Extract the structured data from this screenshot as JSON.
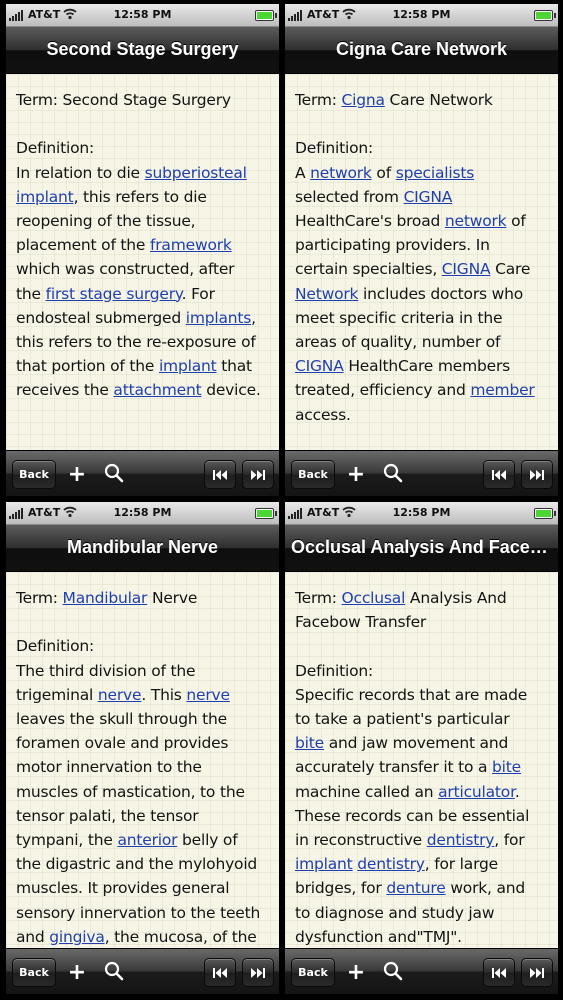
{
  "status_bar": {
    "carrier": "AT&T",
    "time": "12:58 PM"
  },
  "toolbar": {
    "back_label": "Back",
    "add_label": "+"
  },
  "screens": [
    {
      "nav_title": "Second Stage Surgery",
      "lines": [
        [
          {
            "t": "Term: Second Stage Surgery"
          }
        ],
        [],
        [
          {
            "t": "Definition:"
          }
        ],
        [
          {
            "t": "In relation to die "
          },
          {
            "t": "subperiosteal",
            "link": true
          }
        ],
        [
          {
            "t": "implant",
            "link": true
          },
          {
            "t": ", this refers to die"
          }
        ],
        [
          {
            "t": "reopening of the tissue,"
          }
        ],
        [
          {
            "t": "placement of the "
          },
          {
            "t": "framework",
            "link": true
          }
        ],
        [
          {
            "t": "which was constructed, after"
          }
        ],
        [
          {
            "t": "the "
          },
          {
            "t": "first stage surgery",
            "link": true
          },
          {
            "t": ". For"
          }
        ],
        [
          {
            "t": "endosteal submerged "
          },
          {
            "t": "implants",
            "link": true
          },
          {
            "t": ","
          }
        ],
        [
          {
            "t": "this refers to the re-exposure of"
          }
        ],
        [
          {
            "t": "that portion of the "
          },
          {
            "t": "implant",
            "link": true
          },
          {
            "t": " that"
          }
        ],
        [
          {
            "t": "receives the "
          },
          {
            "t": "attachment",
            "link": true
          },
          {
            "t": " device."
          }
        ]
      ]
    },
    {
      "nav_title": "Cigna Care Network",
      "lines": [
        [
          {
            "t": "Term: "
          },
          {
            "t": "Cigna",
            "link": true
          },
          {
            "t": " Care Network"
          }
        ],
        [],
        [
          {
            "t": "Definition:"
          }
        ],
        [
          {
            "t": "A "
          },
          {
            "t": "network",
            "link": true
          },
          {
            "t": " of "
          },
          {
            "t": "specialists",
            "link": true
          }
        ],
        [
          {
            "t": "selected from "
          },
          {
            "t": "CIGNA",
            "link": true
          }
        ],
        [
          {
            "t": "HealthCare's broad "
          },
          {
            "t": "network",
            "link": true
          },
          {
            "t": " of"
          }
        ],
        [
          {
            "t": "participating providers. In"
          }
        ],
        [
          {
            "t": "certain specialties, "
          },
          {
            "t": "CIGNA",
            "link": true
          },
          {
            "t": " Care"
          }
        ],
        [
          {
            "t": "Network",
            "link": true
          },
          {
            "t": " includes doctors who"
          }
        ],
        [
          {
            "t": "meet specific criteria in the"
          }
        ],
        [
          {
            "t": "areas of quality, number of"
          }
        ],
        [
          {
            "t": "CIGNA",
            "link": true
          },
          {
            "t": " HealthCare members"
          }
        ],
        [
          {
            "t": "treated, efficiency and "
          },
          {
            "t": "member",
            "link": true
          }
        ],
        [
          {
            "t": "access."
          }
        ]
      ]
    },
    {
      "nav_title": "Mandibular Nerve",
      "lines": [
        [
          {
            "t": "Term: "
          },
          {
            "t": "Mandibular",
            "link": true
          },
          {
            "t": " Nerve"
          }
        ],
        [],
        [
          {
            "t": "Definition:"
          }
        ],
        [
          {
            "t": "The third division of the"
          }
        ],
        [
          {
            "t": "trigeminal "
          },
          {
            "t": "nerve",
            "link": true
          },
          {
            "t": ". This "
          },
          {
            "t": "nerve",
            "link": true
          }
        ],
        [
          {
            "t": "leaves the skull through the"
          }
        ],
        [
          {
            "t": "foramen ovale and provides"
          }
        ],
        [
          {
            "t": "motor innervation to the"
          }
        ],
        [
          {
            "t": "muscles of mastication, to the"
          }
        ],
        [
          {
            "t": "tensor palati, the tensor"
          }
        ],
        [
          {
            "t": "tympani, the "
          },
          {
            "t": "anterior",
            "link": true
          },
          {
            "t": " belly of"
          }
        ],
        [
          {
            "t": "the digastric and the mylohyoid"
          }
        ],
        [
          {
            "t": "muscles. It provides general"
          }
        ],
        [
          {
            "t": "sensory innervation to the teeth"
          }
        ],
        [
          {
            "t": "and "
          },
          {
            "t": "gingiva",
            "link": true
          },
          {
            "t": ", the mucosa, of the"
          }
        ]
      ]
    },
    {
      "nav_title": "Occlusal Analysis And Facebo...",
      "lines": [
        [
          {
            "t": "Term: "
          },
          {
            "t": "Occlusal",
            "link": true
          },
          {
            "t": " Analysis And"
          }
        ],
        [
          {
            "t": "Facebow Transfer"
          }
        ],
        [],
        [
          {
            "t": "Definition:"
          }
        ],
        [
          {
            "t": "Specific records that are made"
          }
        ],
        [
          {
            "t": "to take a patient's particular"
          }
        ],
        [
          {
            "t": "bite",
            "link": true
          },
          {
            "t": " and jaw movement and"
          }
        ],
        [
          {
            "t": "accurately transfer it to a "
          },
          {
            "t": "bite",
            "link": true
          }
        ],
        [
          {
            "t": "machine called an "
          },
          {
            "t": "articulator",
            "link": true
          },
          {
            "t": "."
          }
        ],
        [
          {
            "t": "These records can be essential"
          }
        ],
        [
          {
            "t": "in reconstructive "
          },
          {
            "t": "dentistry",
            "link": true
          },
          {
            "t": ", for"
          }
        ],
        [
          {
            "t": "implant",
            "link": true
          },
          {
            "t": " "
          },
          {
            "t": "dentistry",
            "link": true
          },
          {
            "t": ", for large"
          }
        ],
        [
          {
            "t": "bridges, for "
          },
          {
            "t": "denture",
            "link": true
          },
          {
            "t": " work, and"
          }
        ],
        [
          {
            "t": "to diagnose and study jaw"
          }
        ],
        [
          {
            "t": "dysfunction and\"TMJ\"."
          }
        ]
      ]
    }
  ]
}
